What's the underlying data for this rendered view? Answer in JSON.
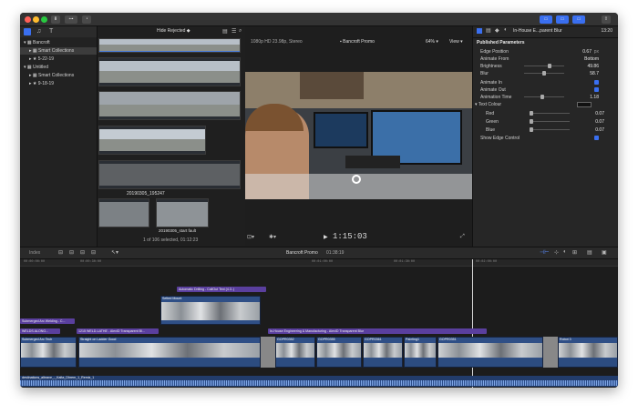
{
  "toolbar": {
    "filter_label": "Hide Rejected",
    "format_label": "1080p HD 23.98p, Stereo",
    "project_label": "Bancroft Promo",
    "zoom_label": "64%",
    "view_label": "View",
    "inspector_title": "In-House E...parent Blur",
    "inspector_time": "13:20"
  },
  "library": {
    "items": [
      {
        "label": "Bancroft",
        "level": 0,
        "selected": false
      },
      {
        "label": "Smart Collections",
        "level": 1,
        "selected": true
      },
      {
        "label": "5-22-19",
        "level": 1,
        "selected": false
      },
      {
        "label": "Untitled",
        "level": 0,
        "selected": false
      },
      {
        "label": "Smart Collections",
        "level": 1,
        "selected": false
      },
      {
        "label": "9-18-19",
        "level": 1,
        "selected": false
      }
    ]
  },
  "browser": {
    "clip_name_1": "20190305_195247",
    "clip_name_2": "20190305_start fault",
    "status": "1 of 106 selected, 01:12:23"
  },
  "viewer": {
    "timecode": "1:15:03"
  },
  "inspector": {
    "section": "Published Parameters",
    "rows": [
      {
        "label": "Edge Position",
        "value": "0.67",
        "unit": "px"
      },
      {
        "label": "Animate From",
        "value": "Bottom"
      },
      {
        "label": "Brightness",
        "value": "49.86"
      },
      {
        "label": "Blur",
        "value": "58.7"
      },
      {
        "label": "Animate In",
        "value": ""
      },
      {
        "label": "Animate Out",
        "value": ""
      },
      {
        "label": "Animation Time",
        "value": "1.18"
      },
      {
        "label": "Text Colour",
        "value": ""
      },
      {
        "label": "Red",
        "value": "0.07"
      },
      {
        "label": "Green",
        "value": "0.07"
      },
      {
        "label": "Blue",
        "value": "0.07"
      },
      {
        "label": "Show Edge Control",
        "value": ""
      }
    ]
  },
  "timeline": {
    "index_label": "Index",
    "project": "Bancroft Promo",
    "duration": "01:38:19",
    "ruler_ticks": [
      "00:00:00:00",
      "00:00:30:00",
      "00:01:00:00",
      "00:01:30:00",
      "00:02:00:00"
    ],
    "titles": [
      {
        "label": "Automatic Drilling - CallOut Text (4.3..)"
      },
      {
        "label": "Submerged Arc Welding - C..."
      },
      {
        "label": "WELDS ALONG..."
      },
      {
        "label": "1215 WELD-LATHE - AlexID Transparent Bl..."
      },
      {
        "label": "In-House Engineering & Manufacturing - AlexID Transparent Blur"
      }
    ],
    "connected_clip": "Setted Mount",
    "primary_clips": [
      {
        "label": "Submerged Arc Tech"
      },
      {
        "label": "Straight on Ladder Good"
      },
      {
        "label": "GOPR0352"
      },
      {
        "label": "GOPR0355"
      },
      {
        "label": "GOPR0361"
      },
      {
        "label": "Painting1"
      },
      {
        "label": "GOPR0351"
      },
      {
        "label": "Robot 3"
      }
    ],
    "audio_label": "destinations_albrave_-_Kalta_Dhrem_1_Remix_1"
  }
}
